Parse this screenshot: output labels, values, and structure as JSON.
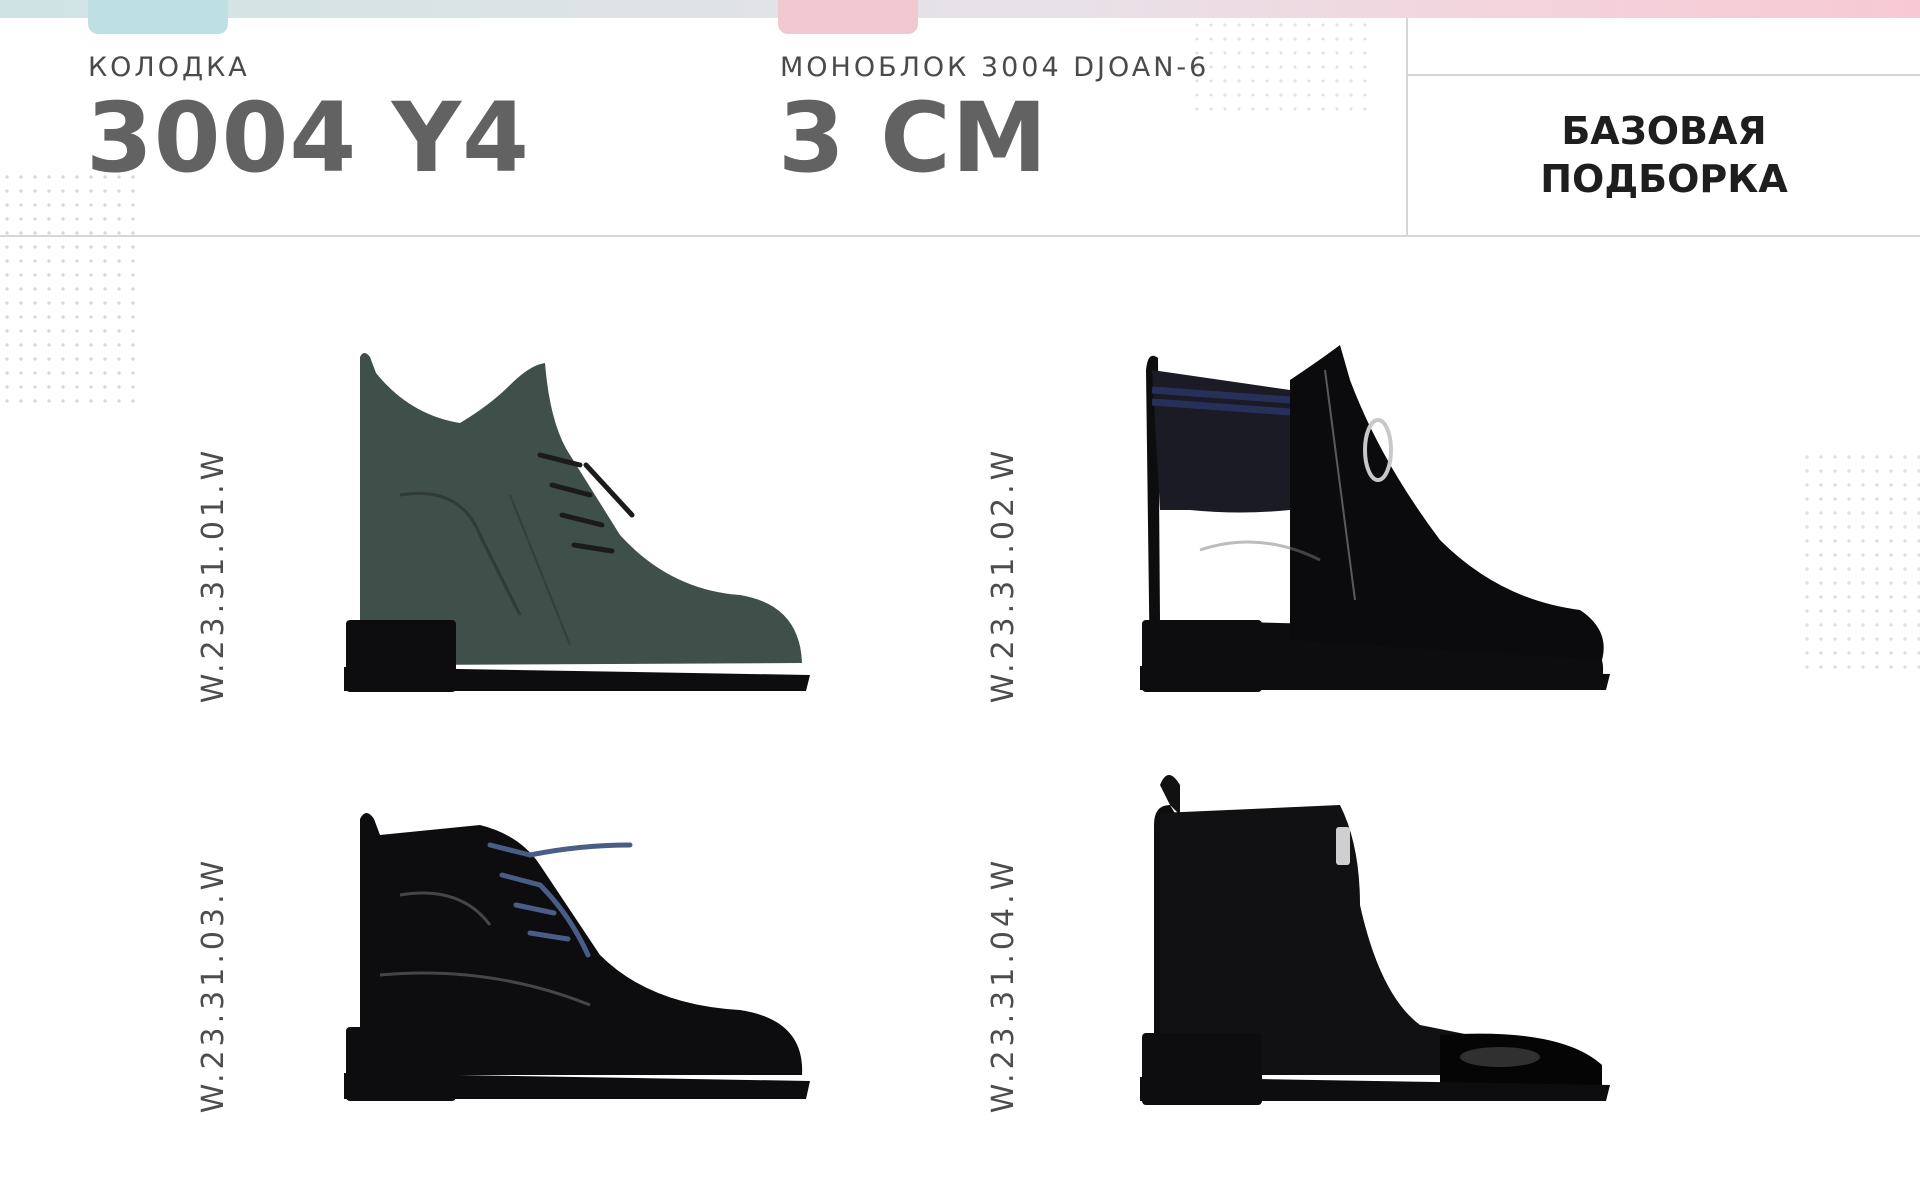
{
  "header": {
    "last_label": "КОЛОДКА",
    "last_value": "3004 Y4",
    "sole_label": "МОНОБЛОК 3004 DJOAN-6",
    "sole_value": "3 CM",
    "collection_line1": "БАЗОВАЯ",
    "collection_line2": "ПОДБОРКА"
  },
  "products": [
    {
      "sku": "W.23.31.01.W",
      "image": "green-leather-lace-up-boot-icon"
    },
    {
      "sku": "W.23.31.02.W",
      "image": "black-patent-zip-boot-icon"
    },
    {
      "sku": "W.23.31.03.W",
      "image": "black-patent-lace-up-boot-icon"
    },
    {
      "sku": "W.23.31.04.W",
      "image": "black-suede-patent-toe-boot-icon"
    }
  ],
  "colors": {
    "boot_green": "#3f4f4a",
    "boot_black": "#0d0d0f",
    "heading_gray": "#626262"
  }
}
